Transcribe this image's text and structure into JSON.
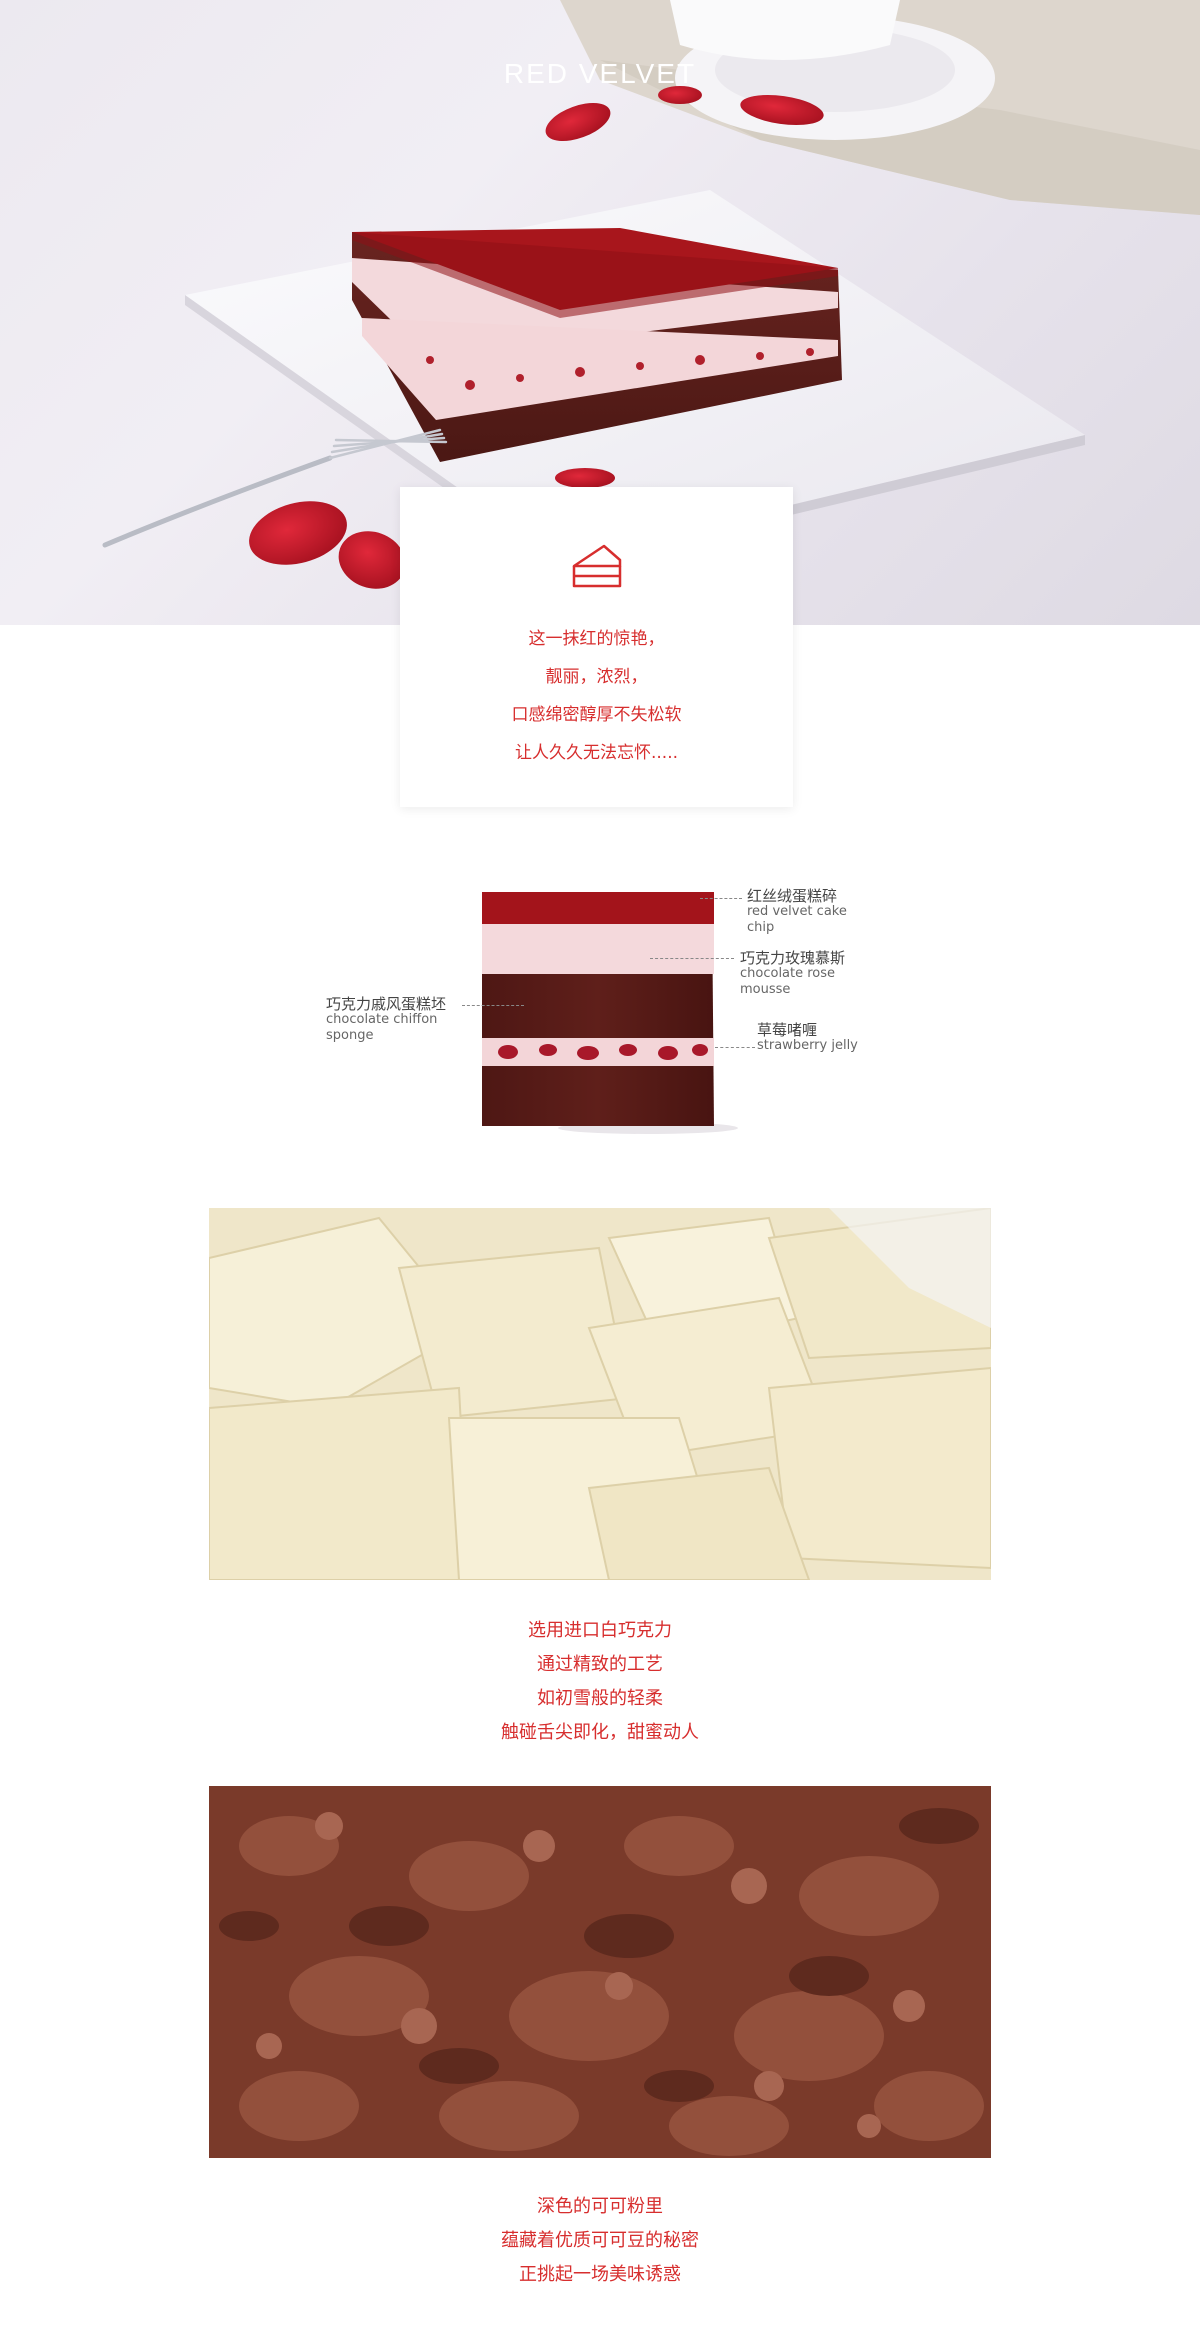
{
  "hero": {
    "title": "RED VELVET"
  },
  "intro": {
    "icon": "cake-slice-icon",
    "lines": [
      "这一抹红的惊艳，",
      "靓丽，浓烈，",
      "口感绵密醇厚不失松软",
      "让人久久无法忘怀....."
    ]
  },
  "layers": [
    {
      "zh": "红丝绒蛋糕碎",
      "en": "red velvet cake chip"
    },
    {
      "zh": "巧克力玫瑰慕斯",
      "en": "chocolate rose mousse"
    },
    {
      "zh": "巧克力戚风蛋糕坯",
      "en": "chocolate chiffon sponge"
    },
    {
      "zh": "草莓啫喱",
      "en": "strawberry jelly"
    }
  ],
  "white_chocolate": {
    "lines": [
      "选用进口白巧克力",
      "通过精致的工艺",
      "如初雪般的轻柔",
      "触碰舌尖即化，甜蜜动人"
    ]
  },
  "cocoa": {
    "lines": [
      "深色的可可粉里",
      "蕴藏着优质可可豆的秘密",
      "正挑起一场美味诱惑"
    ]
  },
  "colors": {
    "accent": "#d72e2e",
    "cake_red": "#a8161c",
    "sponge_brown": "#5a1d18",
    "cream": "#f3d9dc"
  }
}
